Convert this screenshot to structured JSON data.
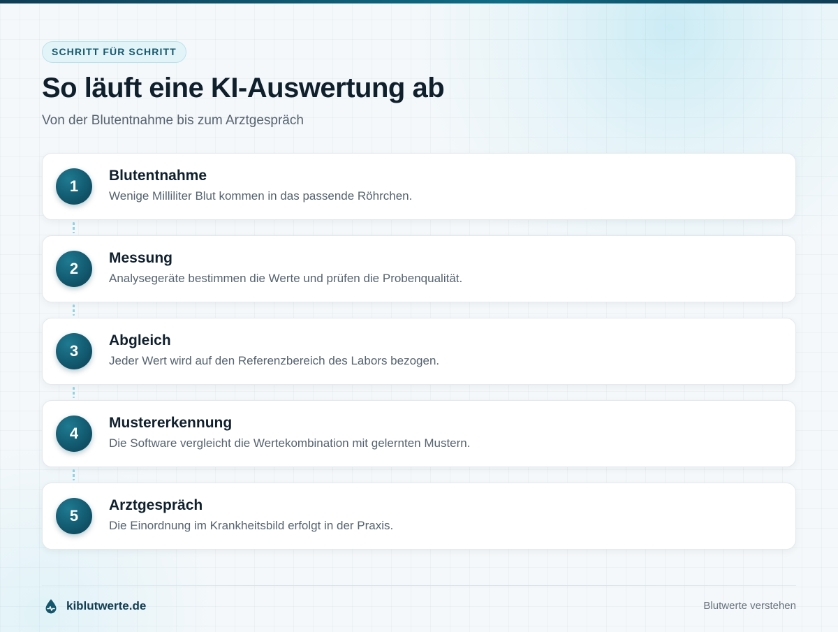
{
  "header": {
    "eyebrow": "SCHRITT FÜR SCHRITT",
    "title": "So läuft eine KI-Auswertung ab",
    "subtitle": "Von der Blutentnahme bis zum Arztgespräch"
  },
  "steps": [
    {
      "number": "1",
      "title": "Blutentnahme",
      "description": "Wenige Milliliter Blut kommen in das passende Röhrchen."
    },
    {
      "number": "2",
      "title": "Messung",
      "description": "Analysegeräte bestimmen die Werte und prüfen die Probenqualität."
    },
    {
      "number": "3",
      "title": "Abgleich",
      "description": "Jeder Wert wird auf den Referenzbereich des Labors bezogen."
    },
    {
      "number": "4",
      "title": "Mustererkennung",
      "description": "Die Software vergleicht die Wertekombination mit gelernten Mustern."
    },
    {
      "number": "5",
      "title": "Arztgespräch",
      "description": "Die Einordnung im Krankheitsbild erfolgt in der Praxis."
    }
  ],
  "footer": {
    "brand": "kiblutwerte.de",
    "brand_icon": "blood-drop-icon",
    "tagline": "Blutwerte verstehen"
  },
  "colors": {
    "accent": "#125a70",
    "connector": "#8fd2e4",
    "title": "#0f1f2c",
    "muted": "#55636f"
  }
}
